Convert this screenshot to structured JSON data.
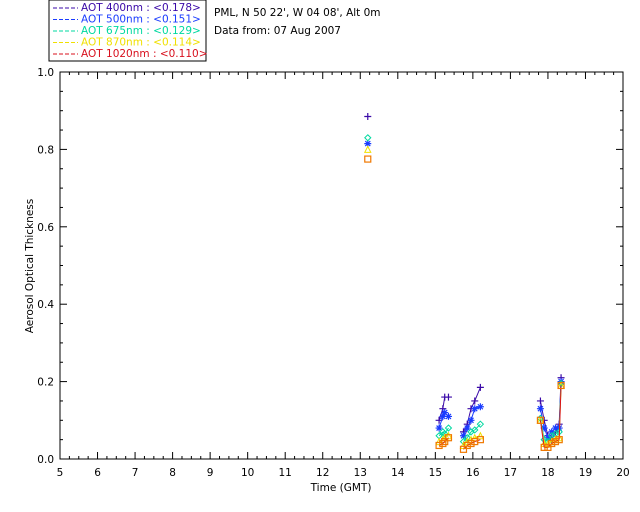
{
  "chart_data": {
    "type": "scatter",
    "title_lines": [
      "PML, N 50 22', W 04 08', Alt 0m",
      "Data from: 07 Aug 2007"
    ],
    "xlabel": "Time (GMT)",
    "ylabel": "Aerosol Optical Thickness",
    "xlim": [
      5,
      20
    ],
    "ylim": [
      0,
      1.0
    ],
    "xticks": [
      5,
      6,
      7,
      8,
      9,
      10,
      11,
      12,
      13,
      14,
      15,
      16,
      17,
      18,
      19,
      20
    ],
    "yticks": [
      0.0,
      0.2,
      0.4,
      0.6,
      0.8,
      1.0
    ],
    "ytick_labels": [
      "0.0",
      "0.2",
      "0.4",
      "0.6",
      "0.8",
      "1.0"
    ],
    "grid": false,
    "legend_position": "top-left, outside plot",
    "series": [
      {
        "name": "AOT  400nm : <0.178>",
        "color": "#3b0aa8",
        "marker": "plus",
        "points": [
          [
            13.2,
            0.885
          ],
          [
            15.1,
            0.1
          ],
          [
            15.2,
            0.13
          ],
          [
            15.25,
            0.16
          ],
          [
            15.35,
            0.16
          ],
          [
            15.75,
            0.07
          ],
          [
            15.85,
            0.09
          ],
          [
            15.95,
            0.13
          ],
          [
            16.05,
            0.15
          ],
          [
            16.2,
            0.185
          ],
          [
            17.8,
            0.15
          ],
          [
            17.9,
            0.1
          ],
          [
            18.0,
            0.06
          ],
          [
            18.1,
            0.05
          ],
          [
            18.2,
            0.07
          ],
          [
            18.3,
            0.09
          ],
          [
            18.35,
            0.21
          ]
        ]
      },
      {
        "name": "AOT  500nm : <0.151>",
        "color": "#1a3cff",
        "marker": "asterisk",
        "points": [
          [
            13.2,
            0.815
          ],
          [
            15.1,
            0.08
          ],
          [
            15.2,
            0.11
          ],
          [
            15.25,
            0.12
          ],
          [
            15.35,
            0.11
          ],
          [
            15.75,
            0.06
          ],
          [
            15.85,
            0.08
          ],
          [
            15.95,
            0.1
          ],
          [
            16.05,
            0.13
          ],
          [
            16.2,
            0.135
          ],
          [
            17.8,
            0.13
          ],
          [
            17.9,
            0.08
          ],
          [
            18.0,
            0.055
          ],
          [
            18.1,
            0.07
          ],
          [
            18.2,
            0.08
          ],
          [
            18.3,
            0.08
          ],
          [
            18.35,
            0.2
          ]
        ]
      },
      {
        "name": "AOT  675nm : <0.129>",
        "color": "#00d9a0",
        "marker": "diamond",
        "points": [
          [
            13.2,
            0.83
          ],
          [
            15.1,
            0.06
          ],
          [
            15.2,
            0.07
          ],
          [
            15.25,
            0.065
          ],
          [
            15.35,
            0.08
          ],
          [
            15.75,
            0.045
          ],
          [
            15.85,
            0.055
          ],
          [
            15.95,
            0.07
          ],
          [
            16.05,
            0.075
          ],
          [
            16.2,
            0.09
          ],
          [
            17.8,
            0.105
          ],
          [
            17.9,
            0.05
          ],
          [
            18.0,
            0.045
          ],
          [
            18.1,
            0.06
          ],
          [
            18.2,
            0.065
          ],
          [
            18.3,
            0.07
          ],
          [
            18.35,
            0.195
          ]
        ]
      },
      {
        "name": "AOT  870nm : <0.114>",
        "color": "#f0e000",
        "marker": "triangle",
        "points": [
          [
            13.2,
            0.8
          ],
          [
            15.1,
            0.045
          ],
          [
            15.2,
            0.05
          ],
          [
            15.25,
            0.055
          ],
          [
            15.35,
            0.06
          ],
          [
            15.75,
            0.035
          ],
          [
            15.85,
            0.045
          ],
          [
            15.95,
            0.05
          ],
          [
            16.05,
            0.055
          ],
          [
            16.2,
            0.06
          ],
          [
            17.8,
            0.1
          ],
          [
            17.9,
            0.04
          ],
          [
            18.0,
            0.038
          ],
          [
            18.1,
            0.045
          ],
          [
            18.2,
            0.05
          ],
          [
            18.3,
            0.055
          ],
          [
            18.35,
            0.19
          ]
        ]
      },
      {
        "name": "AOT 1020nm : <0.110>",
        "color": "#d8101e",
        "marker": "square",
        "markerColor": "#f07800",
        "points": [
          [
            13.2,
            0.775
          ],
          [
            15.1,
            0.035
          ],
          [
            15.2,
            0.04
          ],
          [
            15.25,
            0.045
          ],
          [
            15.35,
            0.055
          ],
          [
            15.75,
            0.025
          ],
          [
            15.85,
            0.035
          ],
          [
            15.95,
            0.04
          ],
          [
            16.05,
            0.045
          ],
          [
            16.2,
            0.05
          ],
          [
            17.8,
            0.1
          ],
          [
            17.9,
            0.03
          ],
          [
            18.0,
            0.03
          ],
          [
            18.1,
            0.04
          ],
          [
            18.2,
            0.045
          ],
          [
            18.3,
            0.05
          ],
          [
            18.35,
            0.19
          ]
        ]
      }
    ]
  }
}
